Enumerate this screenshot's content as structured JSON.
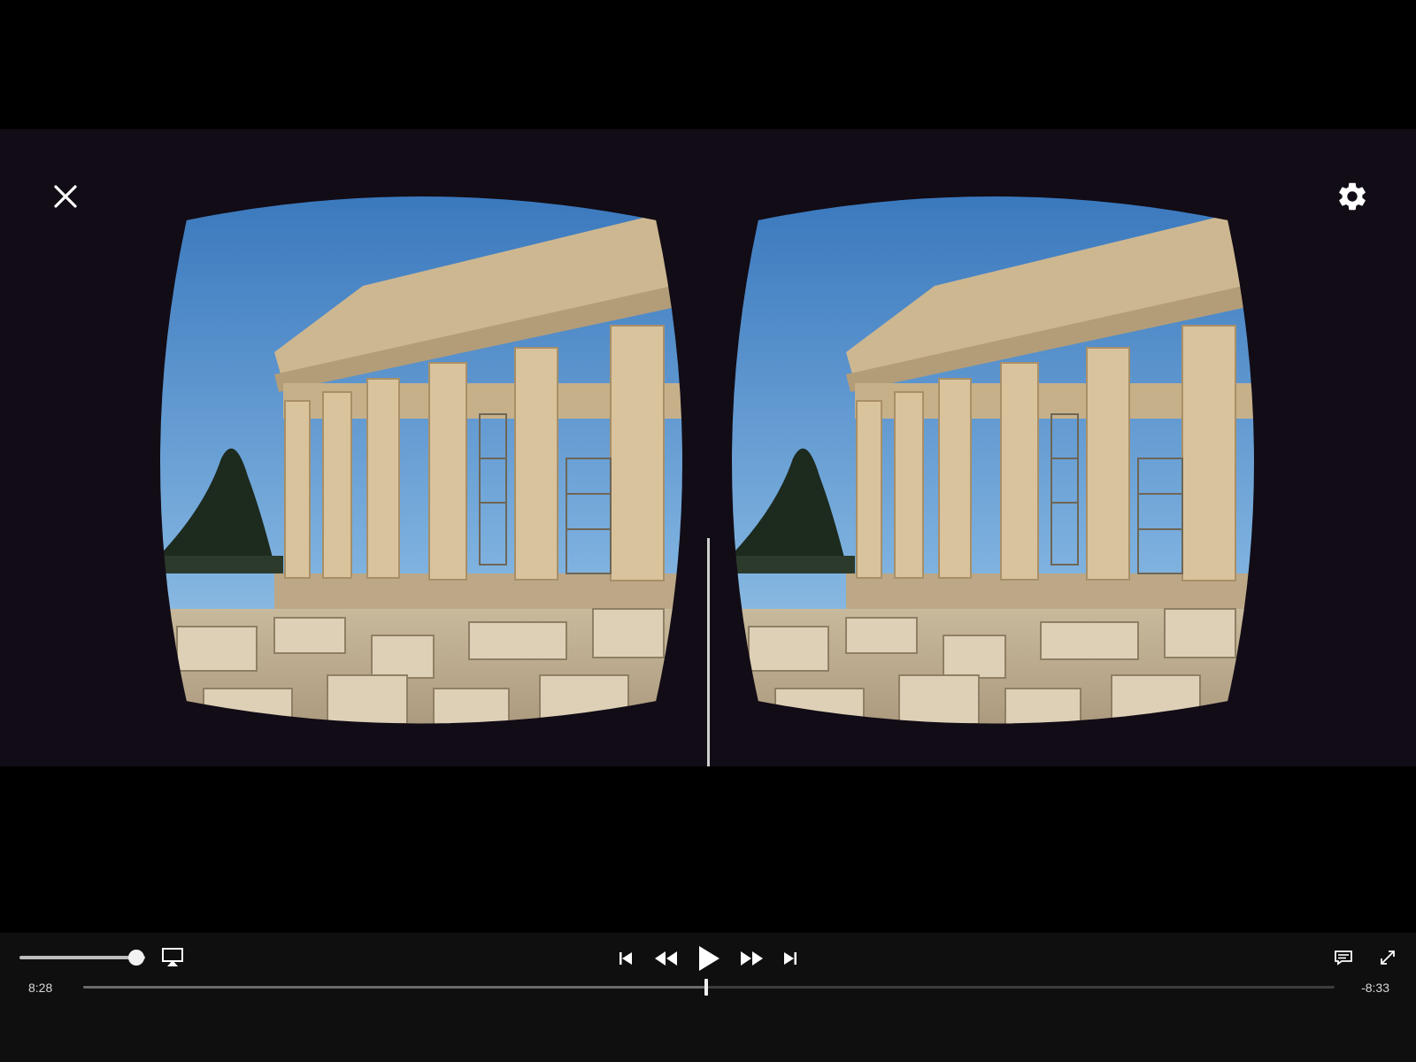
{
  "player": {
    "elapsed_time": "8:28",
    "remaining_time": "-8:33",
    "progress": 0.498,
    "volume": 0.93
  },
  "icons": {
    "close": "close-icon",
    "settings": "gear-icon",
    "airplay": "airplay-icon",
    "previous": "skip-previous-icon",
    "rewind": "rewind-icon",
    "play": "play-icon",
    "fast_forward": "fast-forward-icon",
    "next": "skip-next-icon",
    "captions": "captions-icon",
    "fullscreen": "fullscreen-icon"
  },
  "colors": {
    "background": "#000000",
    "video_background": "#120c16",
    "sky": "#3d7fc0",
    "marble": "#d8c4a0",
    "control_bar": "#0f0f0f"
  }
}
